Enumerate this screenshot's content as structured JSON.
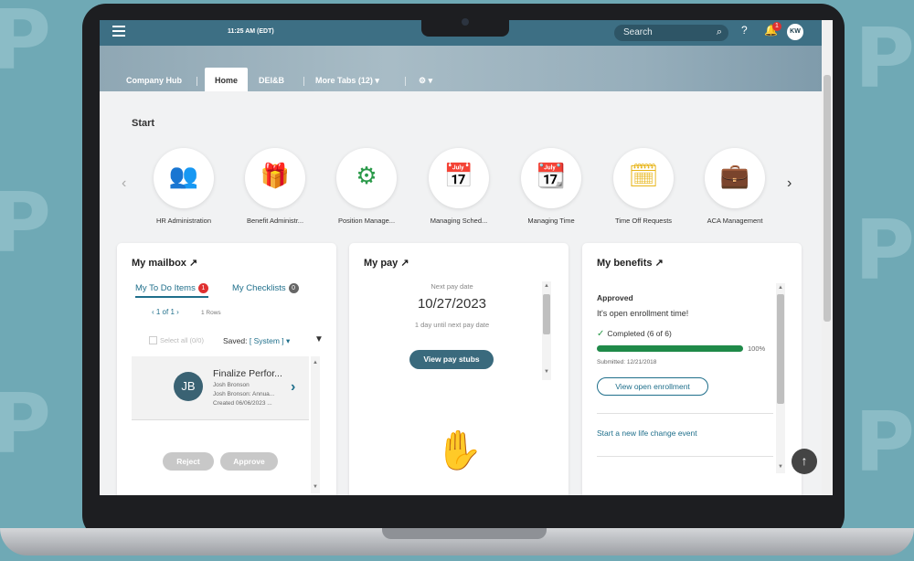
{
  "topbar": {
    "time": "11:25 AM (EDT)",
    "search_placeholder": "Search",
    "notification_count": "1",
    "user_initials": "KW"
  },
  "tabs": [
    {
      "label": "Company Hub"
    },
    {
      "label": "Home"
    },
    {
      "label": "DEI&B"
    },
    {
      "label": "More Tabs (12) ▾"
    },
    {
      "label": "⚙ ▾"
    }
  ],
  "start": {
    "title": "Start",
    "tiles": [
      {
        "label": "HR Administration",
        "icon": "people-icon",
        "glyph": "👥",
        "color": "#3aa0c8"
      },
      {
        "label": "Benefit Administr...",
        "icon": "gift-icon",
        "glyph": "🎁",
        "color": "#8e44ad"
      },
      {
        "label": "Position Manage...",
        "icon": "network-icon",
        "glyph": "⚙",
        "color": "#2b9a4a"
      },
      {
        "label": "Managing Sched...",
        "icon": "calendar-hand-icon",
        "glyph": "📅",
        "color": "#1f6f8b"
      },
      {
        "label": "Managing Time",
        "icon": "calendar-clock-icon",
        "glyph": "📆",
        "color": "#e4582b"
      },
      {
        "label": "Time Off Requests",
        "icon": "calendar-icon",
        "glyph": "🗓",
        "color": "#e7b416"
      },
      {
        "label": "ACA Management",
        "icon": "briefcase-icon",
        "glyph": "💼",
        "color": "#c14f9b"
      }
    ]
  },
  "mailbox": {
    "title": "My mailbox ↗",
    "tab_todo": "My To Do Items",
    "todo_count": "1",
    "tab_checklists": "My Checklists",
    "checklists_count": "0",
    "pager": "‹  1 of 1  ›",
    "rows": "1 Rows",
    "select_all": "Select all (0/0)",
    "saved_label": "Saved:",
    "saved_value": "[ System ] ▾",
    "task": {
      "initials": "JB",
      "title": "Finalize Perfor...",
      "line1": "Josh Bronson",
      "line2": "Josh Bronson: Annua...",
      "line3": "Created 06/06/2023 ..."
    },
    "reject": "Reject",
    "approve": "Approve"
  },
  "pay": {
    "title": "My pay ↗",
    "next_label": "Next pay date",
    "next_date": "10/27/2023",
    "next_sub": "1 day until next pay date",
    "button": "View pay stubs"
  },
  "benefits": {
    "title": "My benefits ↗",
    "status": "Approved",
    "message": "It's open enrollment time!",
    "completed": "Completed (6 of 6)",
    "progress": 1.0,
    "percent": "100%",
    "submitted": "Submitted: 12/21/2018",
    "button": "View open enrollment",
    "link": "Start a new life change event"
  }
}
